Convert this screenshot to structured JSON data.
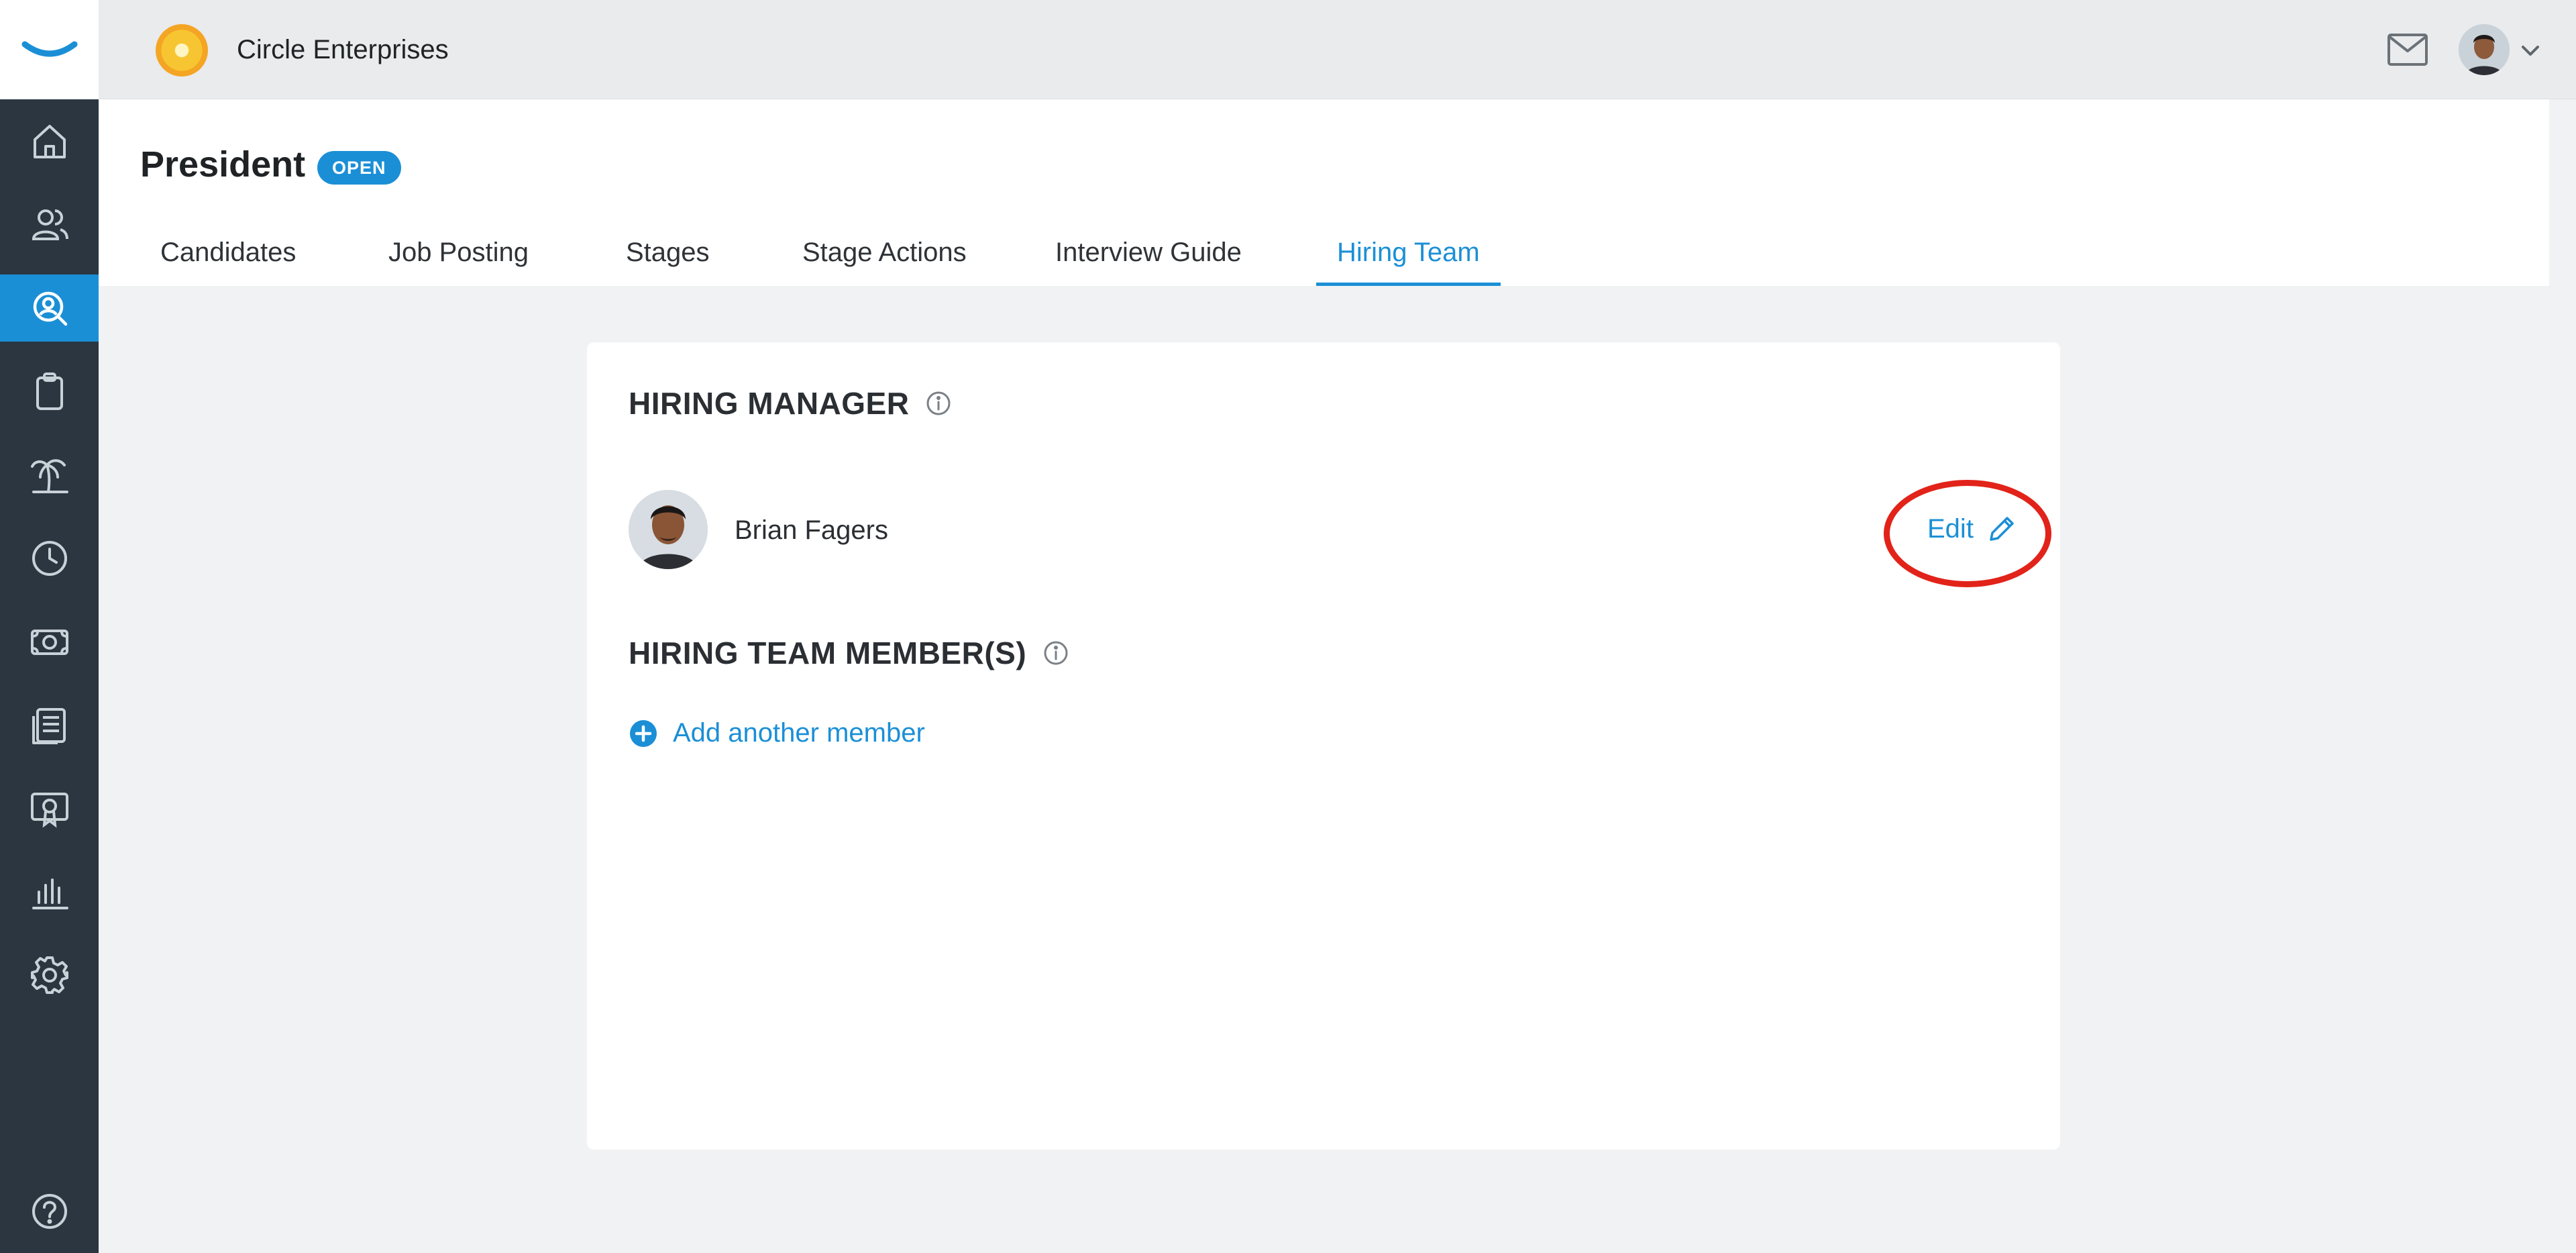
{
  "app": {
    "company_name": "Circle Enterprises",
    "accent_color": "#1b8fd6",
    "nav_bg": "#2b3640",
    "annotation_color": "#e2231a"
  },
  "sidenav": {
    "items": [
      {
        "icon": "home-icon"
      },
      {
        "icon": "people-icon"
      },
      {
        "icon": "recruiting-search-icon",
        "active": true
      },
      {
        "icon": "clipboard-icon"
      },
      {
        "icon": "time-off-palm-icon"
      },
      {
        "icon": "clock-icon"
      },
      {
        "icon": "payroll-money-icon"
      },
      {
        "icon": "documents-icon"
      },
      {
        "icon": "certificate-icon"
      },
      {
        "icon": "reports-chart-icon"
      },
      {
        "icon": "settings-gear-icon"
      },
      {
        "icon": "help-icon"
      }
    ]
  },
  "topbar": {
    "mail_icon": "mail-icon",
    "user_menu_icon": "chevron-down-icon"
  },
  "header": {
    "title": "President",
    "status": "OPEN",
    "tabs": [
      {
        "label": "Candidates"
      },
      {
        "label": "Job Posting"
      },
      {
        "label": "Stages"
      },
      {
        "label": "Stage Actions"
      },
      {
        "label": "Interview Guide"
      },
      {
        "label": "Hiring Team",
        "active": true
      }
    ]
  },
  "card": {
    "hiring_manager_title": "HIRING MANAGER",
    "manager_name": "Brian Fagers",
    "edit_label": "Edit",
    "team_members_title": "HIRING TEAM MEMBER(S)",
    "add_member_label": "Add another member"
  }
}
